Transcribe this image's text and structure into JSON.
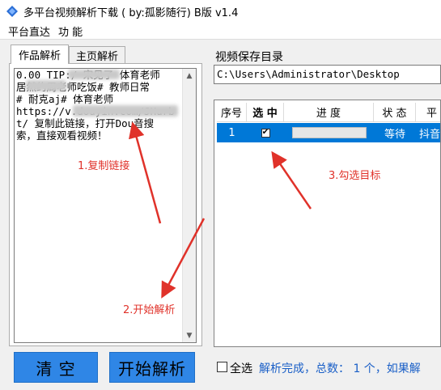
{
  "window": {
    "title": "多平台视频解析下载 ( by:孤影随行) B版 v1.4",
    "icon": "app-logo-icon"
  },
  "menu": [
    {
      "label": "平台直达"
    },
    {
      "label": "功 能"
    }
  ],
  "left_panel": {
    "tabs": [
      {
        "label": "作品解析",
        "active": true
      },
      {
        "label": "主页解析",
        "active": false
      }
    ],
    "share_text": "0.00 TIP:/ 宋见了 体育老师\n居然约周老师吃饭# 教师日常\n# 耐克aj# 体育老师\nhttps://v.douyin.com/JHurb\nt/ 复制此链接，打开Dou音搜\n索，直接观看视频！",
    "clear_button": "清  空",
    "start_button": "开始解析"
  },
  "right_panel": {
    "save_dir_label": "视频保存目录",
    "save_dir_value": "C:\\Users\\Administrator\\Desktop",
    "table": {
      "columns": [
        "序号",
        "选 中",
        "进 度",
        "状 态",
        "平"
      ],
      "rows": [
        {
          "index": "1",
          "checked": true,
          "progress": 0,
          "status": "等待",
          "platform": "抖音"
        }
      ]
    },
    "select_all_label": "全选",
    "status_text": "解析完成，总数： 1 个，如果解"
  },
  "annotations": [
    {
      "label": "1.复制链接"
    },
    {
      "label": "2.开始解析"
    },
    {
      "label": "3.勾选目标"
    }
  ],
  "colors": {
    "button_blue": "#2f86e6",
    "selected_row": "#0078d7",
    "annotation_red": "#e0322a",
    "status_blue": "#1a5fc7"
  }
}
